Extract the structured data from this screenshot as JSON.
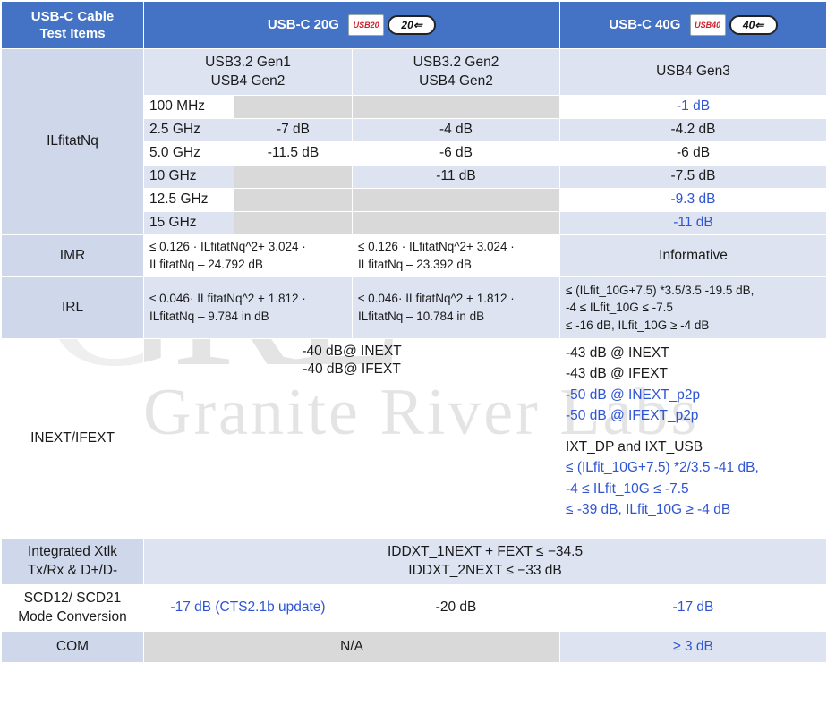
{
  "watermark": {
    "main": "GRL",
    "company": "Granite River Labs"
  },
  "header": {
    "items_label": [
      "USB-C Cable",
      "Test Items"
    ],
    "col20_label": "USB-C 20G",
    "col40_label": "USB-C 40G",
    "logo20_usb": "USB20",
    "logo20_speed": "20⇐",
    "logo40_usb": "USB40",
    "logo40_speed": "40⇐"
  },
  "ilfit": {
    "label": "ILfitatNq",
    "sub_gen1": [
      "USB3.2 Gen1",
      "USB4 Gen2"
    ],
    "sub_gen2": [
      "USB3.2 Gen2",
      "USB4 Gen2"
    ],
    "sub_gen3": "USB4 Gen3",
    "rows": [
      {
        "freq": "100 MHz",
        "gen1": "",
        "gen2": "",
        "gen3": "-1 dB",
        "gen3_blue": true
      },
      {
        "freq": "2.5 GHz",
        "gen1": "-7 dB",
        "gen2": "-4 dB",
        "gen3": "-4.2 dB",
        "gen3_blue": false
      },
      {
        "freq": "5.0 GHz",
        "gen1": "-11.5 dB",
        "gen2": "-6 dB",
        "gen3": "-6 dB",
        "gen3_blue": false
      },
      {
        "freq": "10 GHz",
        "gen1": "",
        "gen2": "-11 dB",
        "gen3": "-7.5 dB",
        "gen3_blue": false
      },
      {
        "freq": "12.5 GHz",
        "gen1": "",
        "gen2": "",
        "gen3": "-9.3 dB",
        "gen3_blue": true
      },
      {
        "freq": "15 GHz",
        "gen1": "",
        "gen2": "",
        "gen3": "-11 dB",
        "gen3_blue": true
      }
    ]
  },
  "imr": {
    "label": "IMR",
    "gen1": [
      "≤ 0.126 · ILfitatNq^2+ 3.024 ·",
      "ILfitatNq – 24.792 dB"
    ],
    "gen2": [
      "≤ 0.126 · ILfitatNq^2+ 3.024 ·",
      "ILfitatNq – 23.392 dB"
    ],
    "gen3": "Informative"
  },
  "irl": {
    "label": "IRL",
    "gen1": [
      "≤ 0.046· ILfitatNq^2 + 1.812 ·",
      "ILfitatNq – 9.784 in dB"
    ],
    "gen2": [
      "≤ 0.046· ILfitatNq^2 + 1.812 ·",
      "ILfitatNq – 10.784 in dB"
    ],
    "gen3": [
      "≤ (ILfit_10G+7.5) *3.5/3.5 -19.5 dB,",
      "-4 ≤ ILfit_10G ≤ -7.5",
      "≤ -16 dB, ILfit_10G ≥ -4 dB"
    ]
  },
  "inext": {
    "label": "INEXT/IFEXT",
    "g20": [
      "-40 dB@ INEXT",
      "-40 dB@ IFEXT"
    ],
    "g40_black": [
      "-43 dB @ INEXT",
      "-43 dB @ IFEXT"
    ],
    "g40_blue": [
      "-50 dB @ INEXT_p2p",
      "-50 dB @ IFEXT_p2p"
    ],
    "g40_ixt_title": "IXT_DP and IXT_USB",
    "g40_ixt_blue": [
      "≤ (ILfit_10G+7.5) *2/3.5 -41 dB,",
      "-4 ≤ ILfit_10G ≤ -7.5",
      "≤ -39 dB, ILfit_10G ≥ -4 dB"
    ]
  },
  "xtlk": {
    "label": [
      "Integrated Xtlk",
      "Tx/Rx & D+/D-"
    ],
    "value": [
      "IDDXT_1NEXT + FEXT ≤ −34.5",
      "IDDXT_2NEXT ≤ −33 dB"
    ]
  },
  "scd": {
    "label": [
      "SCD12/ SCD21",
      "Mode Conversion"
    ],
    "gen1": "-17 dB (CTS2.1b update)",
    "gen2": "-20 dB",
    "gen3": "-17 dB"
  },
  "com": {
    "label": "COM",
    "g20": "N/A",
    "g40": "≥ 3 dB"
  },
  "colors": {
    "header": "#4472c4",
    "label_bg": "#cfd7ea",
    "light_bg": "#dde3f1",
    "gray_bg": "#d9d9d9",
    "blue_text": "#2f55d4"
  }
}
